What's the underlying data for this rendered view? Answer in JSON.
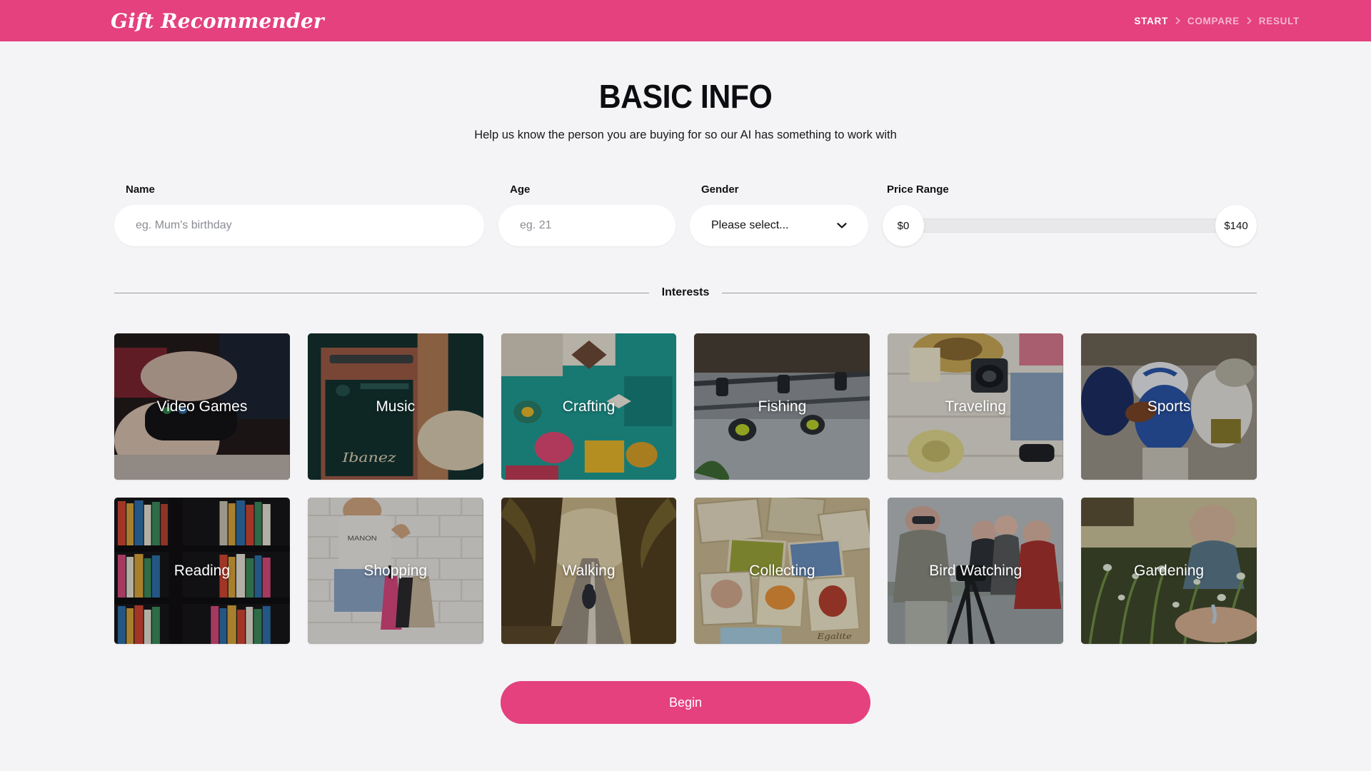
{
  "header": {
    "brand": "Gift Recommender",
    "brand_color": "#ffffff",
    "bar_color": "#e4417e",
    "breadcrumb": {
      "separator_icon": "chevron-right-icon",
      "items": [
        {
          "label": "START",
          "active": true
        },
        {
          "label": "COMPARE",
          "active": false
        },
        {
          "label": "RESULT",
          "active": false
        }
      ]
    }
  },
  "main": {
    "title": "BASIC INFO",
    "subtitle": "Help us know the person you are buying for so our AI has something to work with",
    "background_color": "#f4f4f6"
  },
  "form": {
    "name": {
      "label": "Name",
      "placeholder": "eg. Mum's birthday",
      "value": ""
    },
    "age": {
      "label": "Age",
      "placeholder": "eg. 21",
      "value": ""
    },
    "gender": {
      "label": "Gender",
      "selected": "Please select...",
      "chevron_icon": "chevron-down-icon",
      "options": [
        "Please select..."
      ]
    },
    "price": {
      "label": "Price Range",
      "min_label": "$0",
      "max_label": "$140",
      "min_value": 0,
      "max_value": 140,
      "track_color": "#e8e8ea"
    }
  },
  "interests": {
    "divider_label": "Interests",
    "cards": [
      {
        "label": "Video Games",
        "art": "video-games"
      },
      {
        "label": "Music",
        "art": "music"
      },
      {
        "label": "Crafting",
        "art": "crafting"
      },
      {
        "label": "Fishing",
        "art": "fishing"
      },
      {
        "label": "Traveling",
        "art": "traveling"
      },
      {
        "label": "Sports",
        "art": "sports"
      },
      {
        "label": "Reading",
        "art": "reading"
      },
      {
        "label": "Shopping",
        "art": "shopping"
      },
      {
        "label": "Walking",
        "art": "walking"
      },
      {
        "label": "Collecting",
        "art": "collecting"
      },
      {
        "label": "Bird Watching",
        "art": "bird-watching"
      },
      {
        "label": "Gardening",
        "art": "gardening"
      }
    ]
  },
  "footer": {
    "begin_label": "Begin",
    "begin_color": "#e4417e"
  }
}
